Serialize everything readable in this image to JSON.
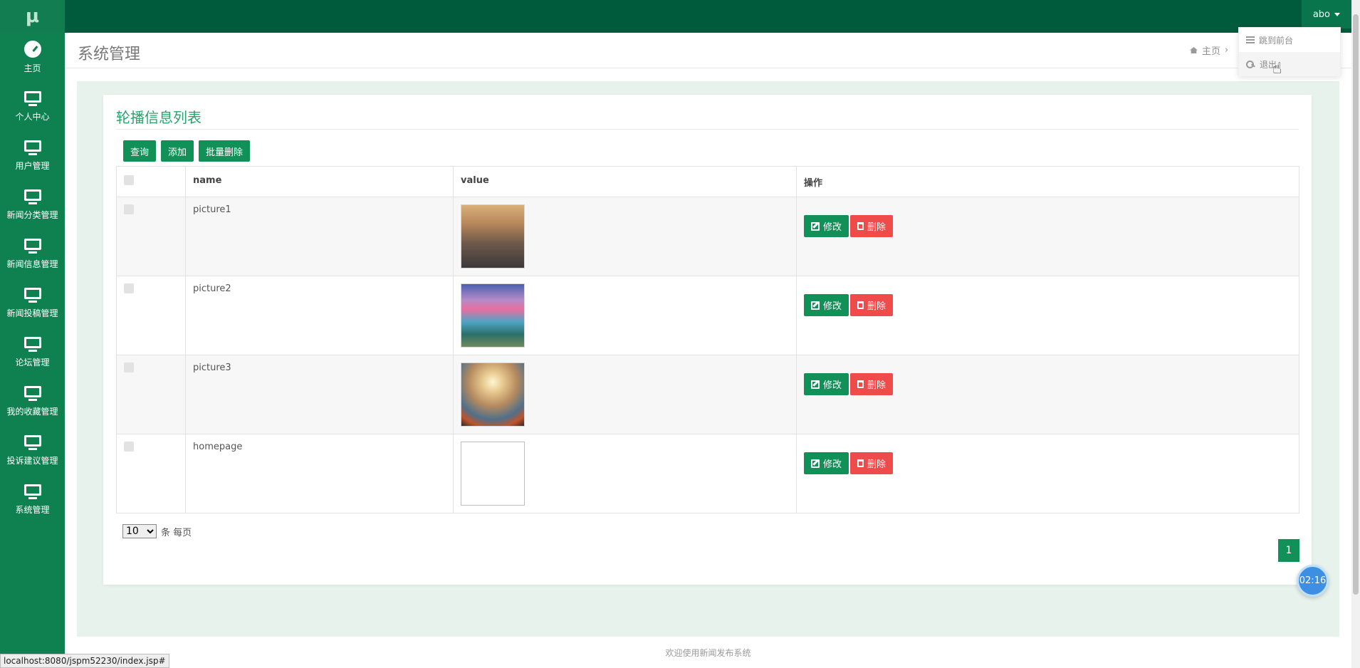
{
  "app": {
    "logo": "μ"
  },
  "topbar": {
    "user": "abo"
  },
  "sidebar": {
    "items": [
      {
        "label": "主页",
        "icon": "dashboard-icon"
      },
      {
        "label": "个人中心",
        "icon": "monitor-icon"
      },
      {
        "label": "用户管理",
        "icon": "monitor-icon"
      },
      {
        "label": "新闻分类管理",
        "icon": "monitor-icon"
      },
      {
        "label": "新闻信息管理",
        "icon": "monitor-icon"
      },
      {
        "label": "新闻投稿管理",
        "icon": "monitor-icon"
      },
      {
        "label": "论坛管理",
        "icon": "monitor-icon"
      },
      {
        "label": "我的收藏管理",
        "icon": "monitor-icon"
      },
      {
        "label": "投诉建议管理",
        "icon": "monitor-icon"
      },
      {
        "label": "系统管理",
        "icon": "monitor-icon"
      }
    ]
  },
  "header": {
    "title": "系统管理",
    "breadcrumb_home": "主页",
    "breadcrumb_sep": "›"
  },
  "dropdown": {
    "items": [
      {
        "label": "跳到前台"
      },
      {
        "label": "退出"
      }
    ]
  },
  "panel": {
    "title": "轮播信息列表",
    "buttons": {
      "query": "查询",
      "add": "添加",
      "batch_delete": "批量删除"
    }
  },
  "table": {
    "headers": {
      "name": "name",
      "value": "value",
      "ops": "操作"
    },
    "rows": [
      {
        "name": "picture1"
      },
      {
        "name": "picture2"
      },
      {
        "name": "picture3"
      },
      {
        "name": "homepage"
      }
    ],
    "edit_label": "修改",
    "delete_label": "删除"
  },
  "pagination": {
    "per_page": "10",
    "per_page_suffix": "条 每页",
    "current_page": "1"
  },
  "timer": "02:16",
  "footer": "欢迎使用新闻发布系统",
  "statusbar": "localhost:8080/jspm52230/index.jsp#",
  "colors": {
    "primary": "#119158",
    "topbar": "#005a3c",
    "sidebar": "#0f8150",
    "danger": "#ef4b4b",
    "title_green": "#29a36b"
  }
}
